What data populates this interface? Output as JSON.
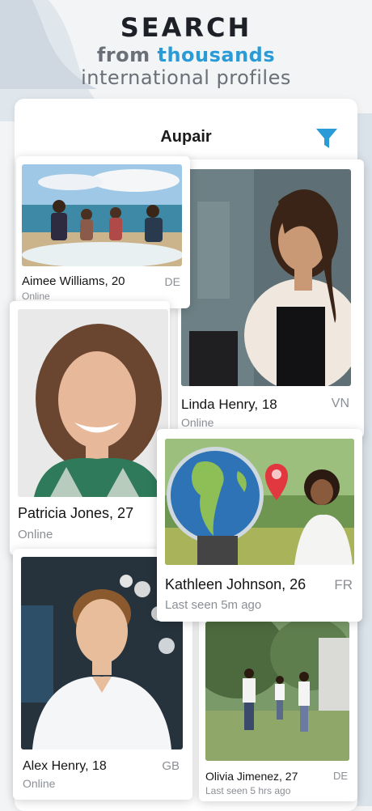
{
  "promo": {
    "line1": "SEARCH",
    "line2_prefix": "from",
    "line2_accent": "thousands",
    "line3": "international profiles"
  },
  "header": {
    "title": "Aupair"
  },
  "icons": {
    "filter": "filter-funnel-icon"
  },
  "colors": {
    "accent": "#2a9bd6",
    "filter": "#2a9bd6"
  },
  "profiles": [
    {
      "name": "Aimee Williams, 20",
      "status": "Online",
      "country": "DE"
    },
    {
      "name": "Linda Henry, 18",
      "status": "Online",
      "country": "VN"
    },
    {
      "name": "Patricia Jones, 27",
      "status": "Online",
      "country": ""
    },
    {
      "name": "Kathleen Johnson, 26",
      "status": "Last seen 5m ago",
      "country": "FR"
    },
    {
      "name": "Alex Henry, 18",
      "status": "Online",
      "country": "GB"
    },
    {
      "name": "Olivia Jimenez, 27",
      "status": "Last seen 5 hrs ago",
      "country": "DE"
    }
  ]
}
